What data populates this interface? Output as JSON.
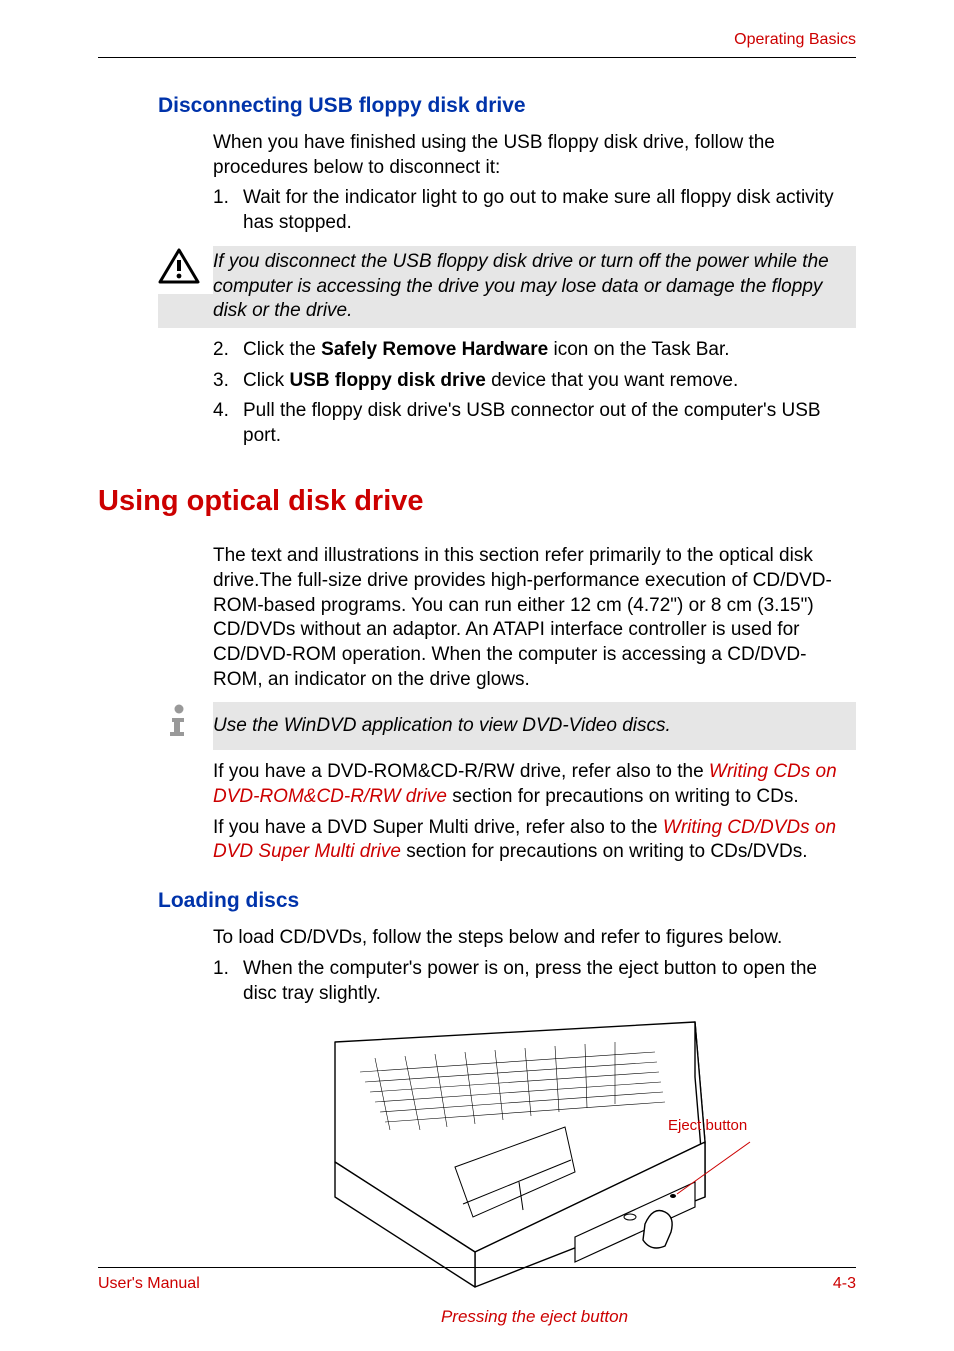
{
  "header": {
    "breadcrumb": "Operating Basics"
  },
  "section1": {
    "heading": "Disconnecting USB floppy disk drive",
    "intro": "When you have finished using the USB floppy disk drive, follow the procedures below to disconnect it:",
    "step1_num": "1.",
    "step1_text": "Wait for the indicator light to go out to make sure all floppy disk activity has stopped.",
    "warning": "If you disconnect the USB floppy disk drive or turn off the power while the computer is accessing the drive you may lose data or damage the floppy disk or the drive.",
    "step2_num": "2.",
    "step2_pre": "Click the ",
    "step2_bold": "Safely Remove Hardware",
    "step2_post": " icon on the Task Bar.",
    "step3_num": "3.",
    "step3_pre": "Click ",
    "step3_bold": "USB floppy disk drive",
    "step3_post": " device that you want remove.",
    "step4_num": "4.",
    "step4_text": "Pull the floppy disk drive's USB connector out of the computer's USB port."
  },
  "section2": {
    "heading": "Using optical disk drive",
    "para1": "The text and illustrations in this section refer primarily to the optical disk drive.The full-size drive provides high-performance execution of CD/DVD-ROM-based programs. You can run either 12 cm (4.72\") or 8 cm (3.15\") CD/DVDs without an adaptor. An ATAPI interface controller is used for CD/DVD-ROM operation. When the computer is accessing a CD/DVD-ROM, an indicator on the drive glows.",
    "info": "Use the WinDVD application to view DVD-Video discs.",
    "para2_pre": "If you have a DVD-ROM&CD-R/RW drive, refer also to the ",
    "para2_link": "Writing CDs on DVD-ROM&CD-R/RW drive",
    "para2_post": " section for precautions on writing to CDs.",
    "para3_pre": "If you have a DVD Super Multi drive, refer also to the ",
    "para3_link": "Writing CD/DVDs on DVD Super Multi drive",
    "para3_post": " section for precautions on writing to CDs/DVDs."
  },
  "section3": {
    "heading": "Loading discs",
    "intro": "To load CD/DVDs, follow the steps below and refer to figures below.",
    "step1_num": "1.",
    "step1_text": "When the computer's power is on, press the eject button to open the disc tray slightly.",
    "eject_label": "Eject button",
    "caption": "Pressing the eject button"
  },
  "footer": {
    "left": "User's Manual",
    "right": "4-3"
  }
}
